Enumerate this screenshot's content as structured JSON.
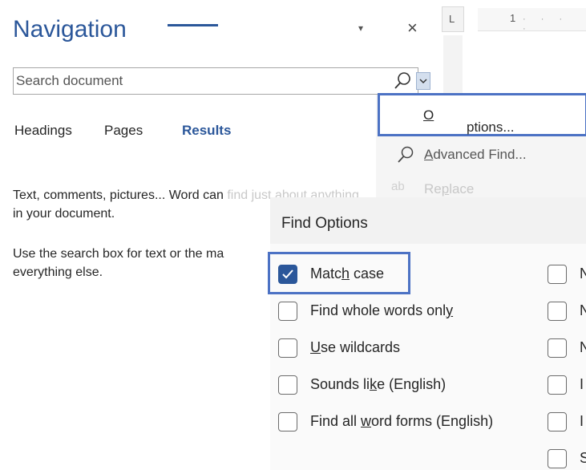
{
  "navigation": {
    "title": "Navigation",
    "close_glyph": "×",
    "dropdown_glyph": "▾",
    "search": {
      "placeholder": "Search document",
      "value": ""
    },
    "tabs": [
      {
        "label": "Headings"
      },
      {
        "label": "Pages"
      },
      {
        "label": "Results",
        "active": true
      }
    ],
    "hint_line_1a": "Text, comments, pictures... Word can ",
    "hint_line_1b": "find just about anything",
    "hint_line_2": "in your document.",
    "hint_line_3a": "Use the search box for text or the ma",
    "hint_line_4": "everything else."
  },
  "ruler": {
    "corner_glyph": "L",
    "number": "1"
  },
  "search_menu": {
    "options_pre": "",
    "options_hot": "O",
    "options_post": "ptions...",
    "advanced_hot": "A",
    "advanced_post": "dvanced Find...",
    "replace_pre": "Re",
    "replace_hot": "p",
    "replace_post": "lace"
  },
  "find_options": {
    "title": "Find Options",
    "left": [
      {
        "pre": "Matc",
        "hot": "h",
        "post": " case",
        "checked": true
      },
      {
        "pre": "Find whole words onl",
        "hot": "y",
        "post": "",
        "checked": false
      },
      {
        "pre": "",
        "hot": "U",
        "post": "se wildcards",
        "checked": false
      },
      {
        "pre": "Sounds li",
        "hot": "k",
        "post": "e (English)",
        "checked": false
      },
      {
        "pre": "Find all ",
        "hot": "w",
        "post": "ord forms (English)",
        "checked": false
      }
    ],
    "right_letters": [
      "N",
      "N",
      "N",
      "I",
      "I",
      "S"
    ]
  },
  "colors": {
    "accent": "#2b579a",
    "highlight": "#4c72c4"
  }
}
